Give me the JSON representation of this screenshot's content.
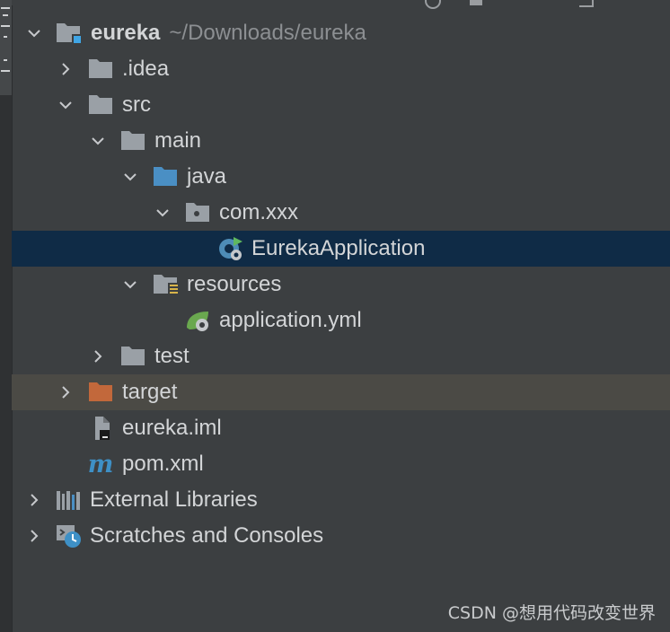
{
  "project_tree": {
    "rows": [
      {
        "id": "eureka",
        "label": "eureka",
        "path": "~/Downloads/eureka",
        "expanded": true
      },
      {
        "id": "idea",
        "label": ".idea",
        "expanded": false
      },
      {
        "id": "src",
        "label": "src",
        "expanded": true
      },
      {
        "id": "main",
        "label": "main",
        "expanded": true
      },
      {
        "id": "java",
        "label": "java",
        "expanded": true
      },
      {
        "id": "com-xxx",
        "label": "com.xxx",
        "expanded": true
      },
      {
        "id": "eureka-application",
        "label": "EurekaApplication",
        "selected": true
      },
      {
        "id": "resources",
        "label": "resources",
        "expanded": true
      },
      {
        "id": "application-yml",
        "label": "application.yml"
      },
      {
        "id": "test",
        "label": "test",
        "expanded": false
      },
      {
        "id": "target",
        "label": "target",
        "expanded": false
      },
      {
        "id": "eureka-iml",
        "label": "eureka.iml"
      },
      {
        "id": "pom-xml",
        "label": "pom.xml"
      },
      {
        "id": "external-libraries",
        "label": "External Libraries",
        "expanded": false
      },
      {
        "id": "scratches",
        "label": "Scratches and Consoles",
        "expanded": false
      }
    ]
  },
  "watermark": "CSDN @想用代码改变世界",
  "colors": {
    "background": "#3c3f41",
    "selected_row": "#0f2b46",
    "excluded_row": "#4b4a45",
    "folder": "#9aa0a6",
    "source_folder": "#4a8fc4",
    "excluded_folder": "#c2683b",
    "spring_green": "#6aa84f",
    "maven_blue": "#3e90c6"
  }
}
